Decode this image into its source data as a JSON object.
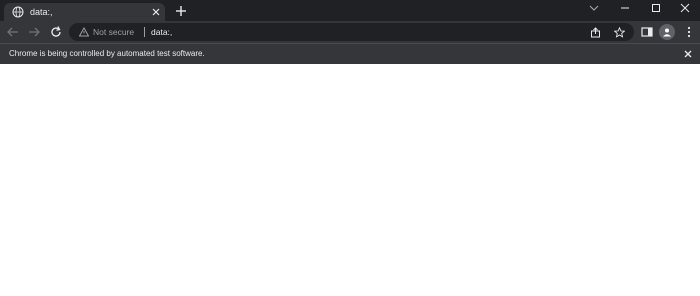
{
  "tab": {
    "title": "data:,",
    "favicon": "globe-icon"
  },
  "toolbar": {
    "security_label": "Not secure",
    "url": "data:,"
  },
  "infobar": {
    "message": "Chrome is being controlled by automated test software."
  },
  "colors": {
    "frame": "#202124",
    "toolbar": "#35363a",
    "text": "#e8eaed",
    "muted": "#9aa0a6",
    "page": "#ffffff"
  }
}
